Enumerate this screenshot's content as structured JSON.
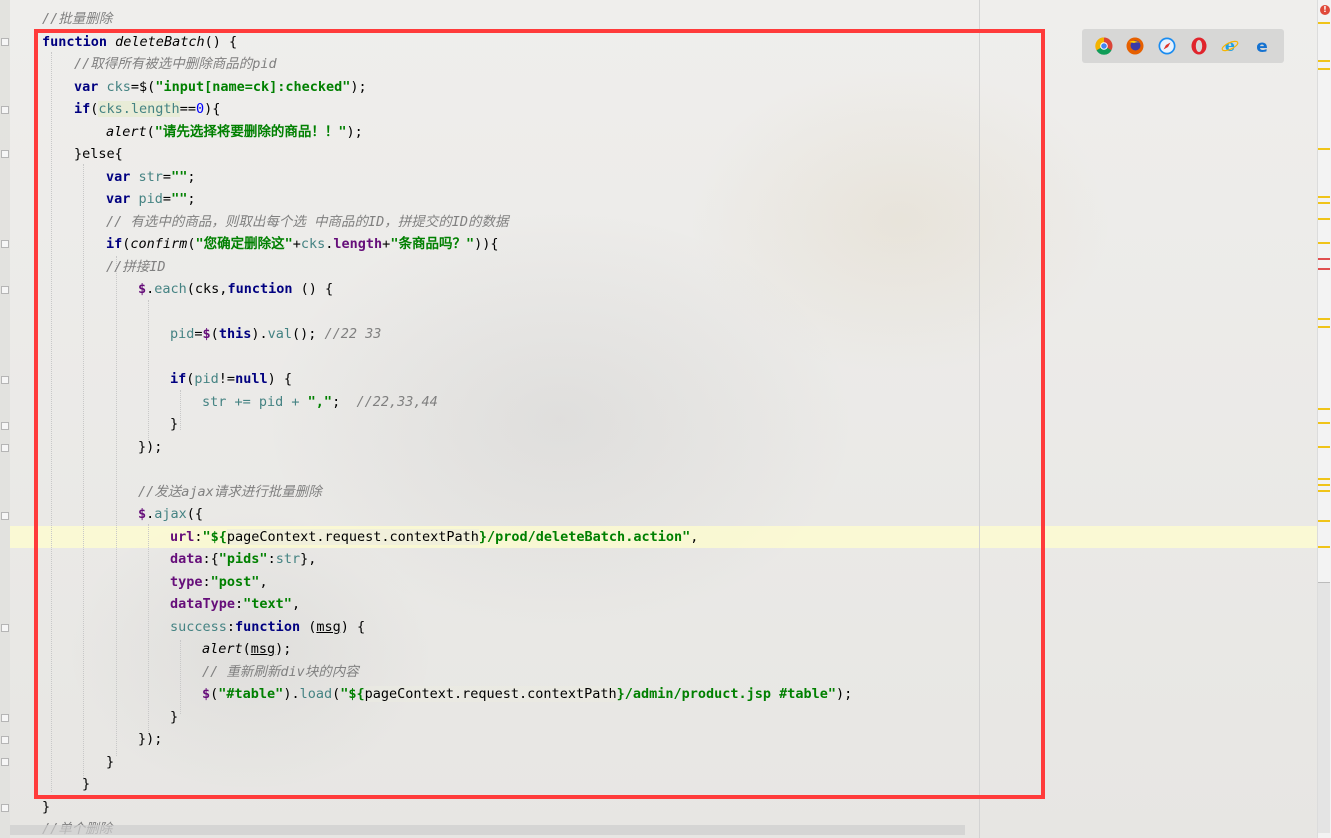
{
  "code": {
    "c_batch_delete": "//批量删除",
    "fn_keyword": "function",
    "fn_name": "deleteBatch",
    "fn_parens": "() {",
    "c_get_checked": "//取得所有被选中删除商品的pid",
    "var_kw": "var",
    "cks": "cks",
    "selector_open": "=$(",
    "selector_str": "\"input[name=ck]:checked\"",
    "selector_close": ");",
    "if_kw": "if",
    "cks_length_check": "cks.length",
    "eq_zero": "==",
    "zero": "0",
    "if_close": "){",
    "alert_fn": "alert",
    "alert_msg": "\"请先选择将要删除的商品！！\"",
    "alert_close": ");",
    "else_line": "}else{",
    "str_var": "str",
    "empty_str": "\"\"",
    "semi": ";",
    "pid_var": "pid",
    "c_take_ids": "// 有选中的商品，则取出每个选 中商品的ID，拼提交的ID的数据",
    "confirm_fn": "confirm",
    "confirm_msg1": "\"您确定删除这\"",
    "plus": "+",
    "length_prop": "length",
    "confirm_msg2": "\"条商品吗？\"",
    "confirm_close": ")){",
    "c_join_id": "//拼接ID",
    "each_fn": "each",
    "each_args": "(cks,",
    "each_fn_kw": "function",
    "each_tail": " () {",
    "pid_assign": "pid=$(",
    "this_kw": "this",
    "val_call": ").val();",
    "val_fn": "val",
    "c_22_33": "//22 33",
    "null_kw": "null",
    "neq": "!=",
    "if_pid_close": ") {",
    "str_append": "str += pid + ",
    "comma_str": "\",\"",
    "c_22_33_44": "//22,33,44",
    "close_brace": "}",
    "close_each": "});",
    "c_send_ajax": "//发送ajax请求进行批量删除",
    "ajax_fn": "ajax",
    "ajax_open": "({",
    "url_key": "url",
    "url_str_open": "\"${",
    "ctx_expr": "pageContext.request.contextPath",
    "url_str_tail": "}/prod/deleteBatch.action\"",
    "data_key": "data",
    "data_val_open": "{",
    "pids_str": "\"pids\"",
    "data_val_close": "},",
    "type_key": "type",
    "post_str": "\"post\"",
    "datatype_key": "dataType",
    "text_str": "\"text\"",
    "success_key": "success",
    "msg_param": "msg",
    "c_refresh": "// 重新刷新div块的内容",
    "table_sel": "\"#table\"",
    "load_fn": "load",
    "load_str_tail": "}/admin/product.jsp #table\"",
    "close_ajax": "});",
    "c_single_delete": "//单个删除"
  },
  "browsers": [
    "chrome-icon",
    "firefox-icon",
    "safari-icon",
    "opera-icon",
    "ie-icon",
    "edge-icon"
  ],
  "colors": {
    "highlight_box": "#ff3b3b",
    "keyword": "#000080",
    "string": "#008000",
    "comment": "#808080",
    "variable": "#458383",
    "property": "#660e7a"
  },
  "badge": "!"
}
